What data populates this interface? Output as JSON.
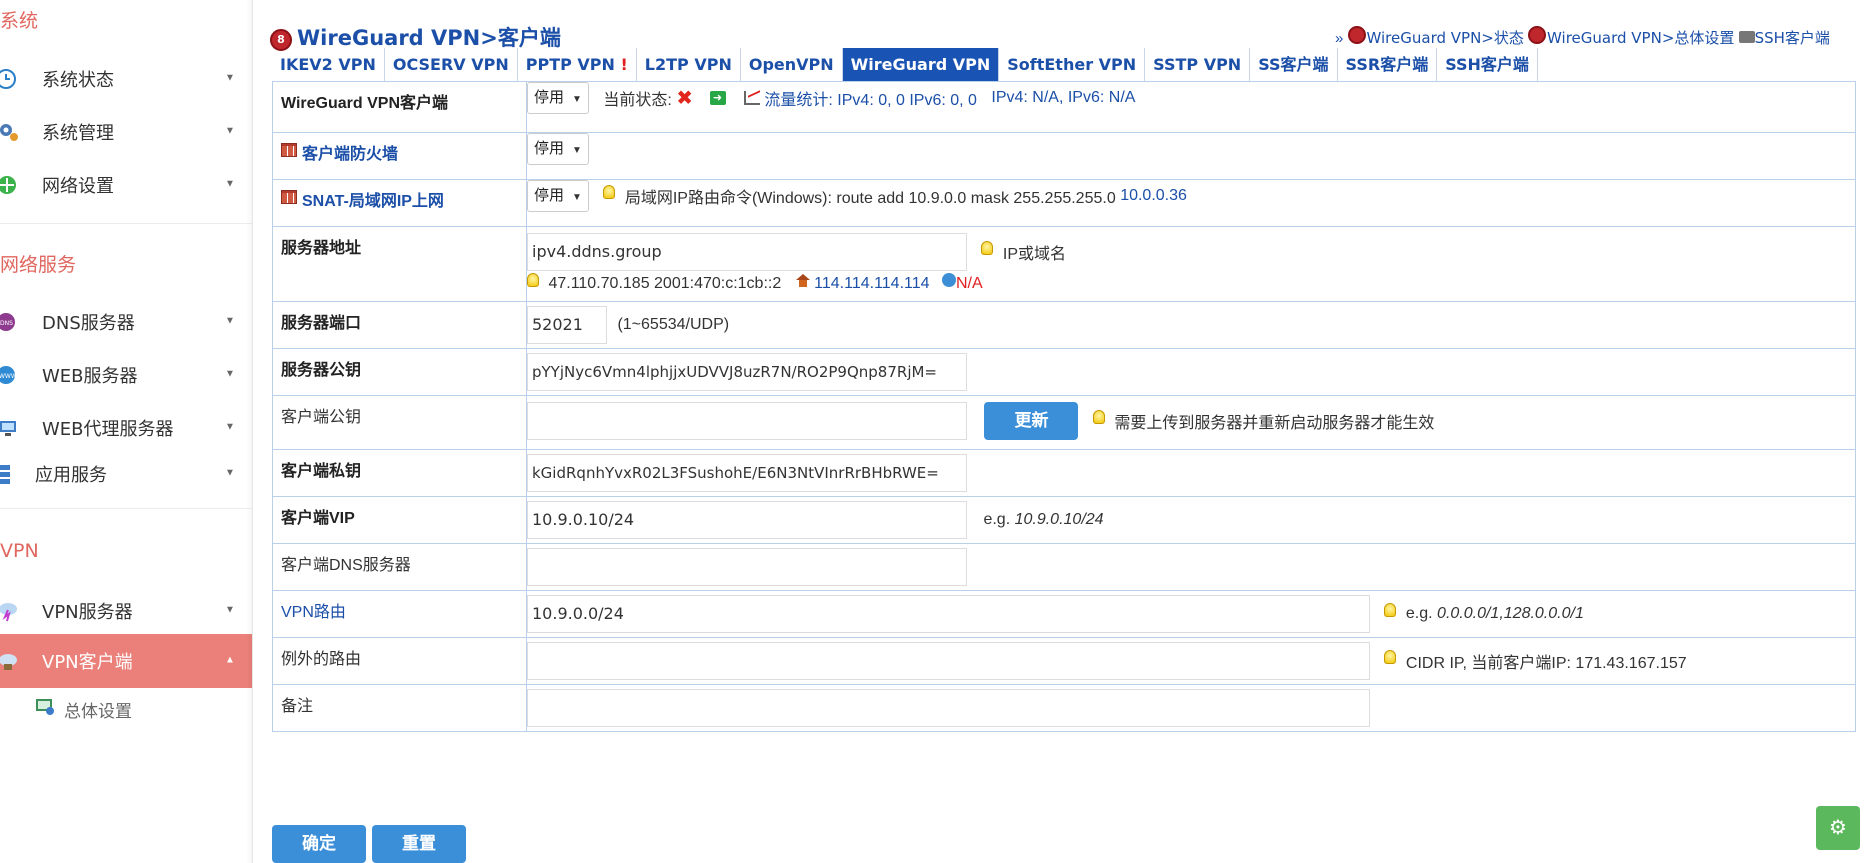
{
  "sidebar": {
    "sections": [
      {
        "title": "系统"
      },
      {
        "title": "网络服务"
      },
      {
        "title": "VPN"
      }
    ],
    "items": [
      {
        "label": "系统状态",
        "icon": "clock-icon"
      },
      {
        "label": "系统管理",
        "icon": "gear-icon"
      },
      {
        "label": "网络设置",
        "icon": "network-icon"
      },
      {
        "label": "DNS服务器",
        "icon": "dns-icon"
      },
      {
        "label": "WEB服务器",
        "icon": "www-icon"
      },
      {
        "label": "WEB代理服务器",
        "icon": "monitor-icon"
      },
      {
        "label": "应用服务",
        "icon": "apps-icon"
      },
      {
        "label": "VPN服务器",
        "icon": "cloud-bolt-icon"
      },
      {
        "label": "VPN客户端",
        "icon": "cloud-icon"
      }
    ],
    "sub_items": [
      {
        "label": "总体设置",
        "icon": "settings-monitor-icon"
      }
    ],
    "active_color": "#ea8079"
  },
  "header": {
    "title": "WireGuard VPN>客户端",
    "top_links": {
      "prefix": "»",
      "status": "WireGuard VPN>状态",
      "general": "WireGuard VPN>总体设置",
      "ssh": "SSH客户端"
    }
  },
  "tabs": [
    {
      "label": "IKEV2 VPN"
    },
    {
      "label": "OCSERV VPN"
    },
    {
      "label": "PPTP VPN",
      "mark": "!"
    },
    {
      "label": "L2TP VPN"
    },
    {
      "label": "OpenVPN"
    },
    {
      "label": "WireGuard VPN",
      "active": true
    },
    {
      "label": "SoftEther VPN"
    },
    {
      "label": "SSTP VPN"
    },
    {
      "label": "SS客户端"
    },
    {
      "label": "SSR客户端"
    },
    {
      "label": "SSH客户端"
    }
  ],
  "form": {
    "client": {
      "label": "WireGuard VPN客户端",
      "select": "停用",
      "status_label": "当前状态:",
      "traffic_label": "流量统计: IPv4: 0, 0 IPv6: 0, 0",
      "addr_info": "IPv4: N/A, IPv6: N/A"
    },
    "firewall": {
      "label": "客户端防火墙",
      "select": "停用"
    },
    "snat": {
      "label": "SNAT-局域网IP上网",
      "select": "停用",
      "hint": "局域网IP路由命令(Windows): route add 10.9.0.0 mask 255.255.255.0",
      "gateway": "10.0.0.36"
    },
    "server_addr": {
      "label": "服务器地址",
      "value": "ipv4.ddns.group",
      "hint": "IP或域名",
      "resolved": "47.110.70.185 2001:470:c:1cb::2",
      "dns": "114.114.114.114",
      "na": "N/A"
    },
    "server_port": {
      "label": "服务器端口",
      "value": "52021",
      "hint": "(1~65534/UDP)"
    },
    "server_pubkey": {
      "label": "服务器公钥",
      "value": "pYYjNyc6Vmn4lphjjxUDVVJ8uzR7N/RO2P9Qnp87RjM="
    },
    "client_pubkey": {
      "label": "客户端公钥",
      "value": "",
      "button": "更新",
      "hint": "需要上传到服务器并重新启动服务器才能生效"
    },
    "client_privkey": {
      "label": "客户端私钥",
      "value": "kGidRqnhYvxR02L3FSushohE/E6N3NtVInrRrBHbRWE="
    },
    "client_vip": {
      "label": "客户端VIP",
      "value": "10.9.0.10/24",
      "eg_prefix": "e.g.",
      "eg": "10.9.0.10/24"
    },
    "client_dns": {
      "label": "客户端DNS服务器",
      "value": ""
    },
    "vpn_route": {
      "label": "VPN路由",
      "value": "10.9.0.0/24",
      "eg_prefix": "e.g.",
      "eg": "0.0.0.0/1,128.0.0.0/1"
    },
    "exclude_route": {
      "label": "例外的路由",
      "value": "",
      "hint": "CIDR IP, 当前客户端IP: 171.43.167.157"
    },
    "note": {
      "label": "备注",
      "value": ""
    }
  },
  "buttons": {
    "confirm": "确定",
    "reset": "重置"
  },
  "colors": {
    "accent": "#1953b3",
    "link": "#1b4fa8",
    "button": "#3a8fd8",
    "fab": "#5cb85c"
  }
}
